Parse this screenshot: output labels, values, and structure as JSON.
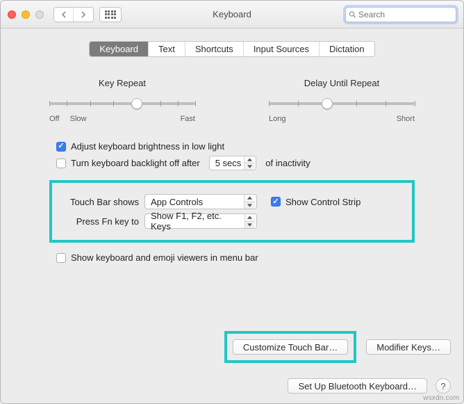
{
  "window": {
    "title": "Keyboard"
  },
  "search": {
    "placeholder": "Search",
    "value": ""
  },
  "tabs": {
    "keyboard": "Keyboard",
    "text": "Text",
    "shortcuts": "Shortcuts",
    "input_sources": "Input Sources",
    "dictation": "Dictation"
  },
  "sliders": {
    "key_repeat": {
      "title": "Key Repeat",
      "left": "Off",
      "left2": "Slow",
      "right": "Fast"
    },
    "delay": {
      "title": "Delay Until Repeat",
      "left": "Long",
      "right": "Short"
    }
  },
  "options": {
    "adjust_brightness": "Adjust keyboard brightness in low light",
    "backlight_off_prefix": "Turn keyboard backlight off after",
    "backlight_off_value": "5 secs",
    "backlight_off_suffix": "of inactivity",
    "show_viewers": "Show keyboard and emoji viewers in menu bar"
  },
  "touchbar": {
    "shows_label": "Touch Bar shows",
    "shows_value": "App Controls",
    "show_strip": "Show Control Strip",
    "fn_label": "Press Fn key to",
    "fn_value": "Show F1, F2, etc. Keys"
  },
  "buttons": {
    "customize": "Customize Touch Bar…",
    "modifier": "Modifier Keys…",
    "bluetooth": "Set Up Bluetooth Keyboard…",
    "help": "?"
  },
  "watermark": "wsxdn.com"
}
